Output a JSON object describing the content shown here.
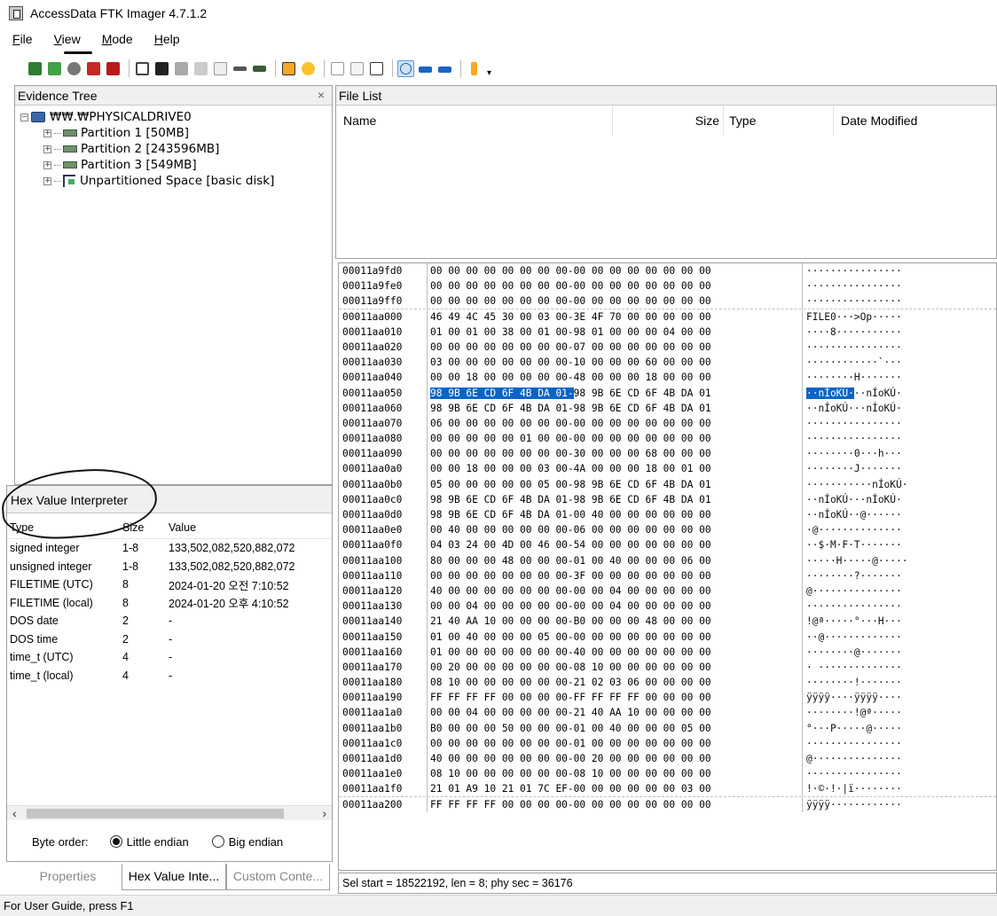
{
  "window": {
    "title": "AccessData FTK Imager 4.7.1.2"
  },
  "menu": [
    "File",
    "View",
    "Mode",
    "Help"
  ],
  "toolbar": {
    "icons": [
      "add-evidence-icon",
      "add-all-attached-devices-icon",
      "image-mounting-icon",
      "remove-evidence-icon",
      "remove-all-evidence-icon",
      "create-disk-image-icon",
      "export-disk-image-icon",
      "export-logical-image-icon",
      "capture-memory-icon",
      "obtain-protected-files-icon",
      "detect-efs-icon",
      "export-files-icon",
      "export-file-hash-list-icon",
      "add-to-custom-content-icon",
      "create-custom-content-image-icon",
      "decrypt-ad1-icon",
      "view-files-in-plain-text-icon",
      "view-files-in-text-mode-icon",
      "view-files-in-hex-mode-icon",
      "help-icon"
    ]
  },
  "evidence_tree": {
    "title": "Evidence Tree",
    "root": "₩₩.₩PHYSICALDRIVE0",
    "children": [
      "Partition 1 [50MB]",
      "Partition 2 [243596MB]",
      "Partition 3 [549MB]",
      "Unpartitioned Space [basic disk]"
    ]
  },
  "file_list": {
    "title": "File List",
    "columns": {
      "name": "Name",
      "size": "Size",
      "type": "Type",
      "date": "Date Modified"
    }
  },
  "hex_interpreter": {
    "title": "Hex Value Interpreter",
    "headers": {
      "type": "Type",
      "size": "Size",
      "value": "Value"
    },
    "rows": [
      {
        "type": "signed integer",
        "size": "1-8",
        "value": "133,502,082,520,882,072"
      },
      {
        "type": "unsigned integer",
        "size": "1-8",
        "value": "133,502,082,520,882,072"
      },
      {
        "type": "FILETIME (UTC)",
        "size": "8",
        "value": "2024-01-20 오전 7:10:52"
      },
      {
        "type": "FILETIME (local)",
        "size": "8",
        "value": "2024-01-20 오후 4:10:52"
      },
      {
        "type": "DOS date",
        "size": "2",
        "value": "-"
      },
      {
        "type": "DOS time",
        "size": "2",
        "value": "-"
      },
      {
        "type": "time_t (UTC)",
        "size": "4",
        "value": "-"
      },
      {
        "type": "time_t (local)",
        "size": "4",
        "value": "-"
      }
    ],
    "byte_order": {
      "label": "Byte order:",
      "little": "Little endian",
      "big": "Big endian",
      "selected": "little"
    }
  },
  "tabs": {
    "properties": "Properties",
    "hex_value": "Hex Value Inte...",
    "custom": "Custom Conte..."
  },
  "hex_view": {
    "lines": [
      {
        "off": "00011a9fd0",
        "bytes": "00 00 00 00 00 00 00 00-00 00 00 00 00 00 00 00",
        "ascii": "················"
      },
      {
        "off": "00011a9fe0",
        "bytes": "00 00 00 00 00 00 00 00-00 00 00 00 00 00 00 00",
        "ascii": "················"
      },
      {
        "off": "00011a9ff0",
        "bytes": "00 00 00 00 00 00 00 00-00 00 00 00 00 00 00 00",
        "ascii": "················",
        "sector_end": true
      },
      {
        "off": "00011aa000",
        "bytes": "46 49 4C 45 30 00 03 00-3E 4F 70 00 00 00 00 00",
        "ascii": "FILE0···>Op·····"
      },
      {
        "off": "00011aa010",
        "bytes": "01 00 01 00 38 00 01 00-98 01 00 00 00 04 00 00",
        "ascii": "····8···········"
      },
      {
        "off": "00011aa020",
        "bytes": "00 00 00 00 00 00 00 00-07 00 00 00 00 00 00 00",
        "ascii": "················"
      },
      {
        "off": "00011aa030",
        "bytes": "03 00 00 00 00 00 00 00-10 00 00 00 60 00 00 00",
        "ascii": "············`···"
      },
      {
        "off": "00011aa040",
        "bytes": "00 00 18 00 00 00 00 00-48 00 00 00 18 00 00 00",
        "ascii": "········H·······"
      },
      {
        "off": "00011aa050",
        "bytes": "98 9B 6E CD 6F 4B DA 01-98 9B 6E CD 6F 4B DA 01",
        "ascii": "··nÍoKÚ···nÍoKÚ·",
        "sel_bytes": 24,
        "sel_ascii": 8
      },
      {
        "off": "00011aa060",
        "bytes": "98 9B 6E CD 6F 4B DA 01-98 9B 6E CD 6F 4B DA 01",
        "ascii": "··nÍoKÚ···nÍoKÚ·"
      },
      {
        "off": "00011aa070",
        "bytes": "06 00 00 00 00 00 00 00-00 00 00 00 00 00 00 00",
        "ascii": "················"
      },
      {
        "off": "00011aa080",
        "bytes": "00 00 00 00 00 01 00 00-00 00 00 00 00 00 00 00",
        "ascii": "················"
      },
      {
        "off": "00011aa090",
        "bytes": "00 00 00 00 00 00 00 00-30 00 00 00 68 00 00 00",
        "ascii": "········0···h···"
      },
      {
        "off": "00011aa0a0",
        "bytes": "00 00 18 00 00 00 03 00-4A 00 00 00 18 00 01 00",
        "ascii": "········J·······"
      },
      {
        "off": "00011aa0b0",
        "bytes": "05 00 00 00 00 00 05 00-98 9B 6E CD 6F 4B DA 01",
        "ascii": "···········nÍoKÚ·"
      },
      {
        "off": "00011aa0c0",
        "bytes": "98 9B 6E CD 6F 4B DA 01-98 9B 6E CD 6F 4B DA 01",
        "ascii": "··nÍoKÚ···nÍoKÚ·"
      },
      {
        "off": "00011aa0d0",
        "bytes": "98 9B 6E CD 6F 4B DA 01-00 40 00 00 00 00 00 00",
        "ascii": "··nÍoKÚ··@······"
      },
      {
        "off": "00011aa0e0",
        "bytes": "00 40 00 00 00 00 00 00-06 00 00 00 00 00 00 00",
        "ascii": "·@··············"
      },
      {
        "off": "00011aa0f0",
        "bytes": "04 03 24 00 4D 00 46 00-54 00 00 00 00 00 00 00",
        "ascii": "··$·M·F·T·······"
      },
      {
        "off": "00011aa100",
        "bytes": "80 00 00 00 48 00 00 00-01 00 40 00 00 00 06 00",
        "ascii": "·····H·····@·····"
      },
      {
        "off": "00011aa110",
        "bytes": "00 00 00 00 00 00 00 00-3F 00 00 00 00 00 00 00",
        "ascii": "········?·······"
      },
      {
        "off": "00011aa120",
        "bytes": "40 00 00 00 00 00 00 00-00 00 04 00 00 00 00 00",
        "ascii": "@···············"
      },
      {
        "off": "00011aa130",
        "bytes": "00 00 04 00 00 00 00 00-00 00 04 00 00 00 00 00",
        "ascii": "················"
      },
      {
        "off": "00011aa140",
        "bytes": "21 40 AA 10 00 00 00 00-B0 00 00 00 48 00 00 00",
        "ascii": "!@ª·····°···H···"
      },
      {
        "off": "00011aa150",
        "bytes": "01 00 40 00 00 00 05 00-00 00 00 00 00 00 00 00",
        "ascii": "··@·············"
      },
      {
        "off": "00011aa160",
        "bytes": "01 00 00 00 00 00 00 00-40 00 00 00 00 00 00 00",
        "ascii": "········@·······"
      },
      {
        "off": "00011aa170",
        "bytes": "00 20 00 00 00 00 00 00-08 10 00 00 00 00 00 00",
        "ascii": "· ··············"
      },
      {
        "off": "00011aa180",
        "bytes": "08 10 00 00 00 00 00 00-21 02 03 06 00 00 00 00",
        "ascii": "········!·······"
      },
      {
        "off": "00011aa190",
        "bytes": "FF FF FF FF 00 00 00 00-FF FF FF FF 00 00 00 00",
        "ascii": "ÿÿÿÿ····ÿÿÿÿ····"
      },
      {
        "off": "00011aa1a0",
        "bytes": "00 00 04 00 00 00 00 00-21 40 AA 10 00 00 00 00",
        "ascii": "········!@ª·····"
      },
      {
        "off": "00011aa1b0",
        "bytes": "B0 00 00 00 50 00 00 00-01 00 40 00 00 00 05 00",
        "ascii": "°···P·····@·····"
      },
      {
        "off": "00011aa1c0",
        "bytes": "00 00 00 00 00 00 00 00-01 00 00 00 00 00 00 00",
        "ascii": "················"
      },
      {
        "off": "00011aa1d0",
        "bytes": "40 00 00 00 00 00 00 00-00 20 00 00 00 00 00 00",
        "ascii": "@···············"
      },
      {
        "off": "00011aa1e0",
        "bytes": "08 10 00 00 00 00 00 00-08 10 00 00 00 00 00 00",
        "ascii": "················"
      },
      {
        "off": "00011aa1f0",
        "bytes": "21 01 A9 10 21 01 7C EF-00 00 00 00 00 00 03 00",
        "ascii": "!·©·!·|ï········",
        "sector_end": true
      },
      {
        "off": "00011aa200",
        "bytes": "FF FF FF FF 00 00 00 00-00 00 00 00 00 00 00 00",
        "ascii": "ÿÿÿÿ············"
      }
    ]
  },
  "status": {
    "selection": "Sel start = 18522192, len = 8; phy sec = 36176"
  },
  "bottom_status": "For User Guide, press F1"
}
